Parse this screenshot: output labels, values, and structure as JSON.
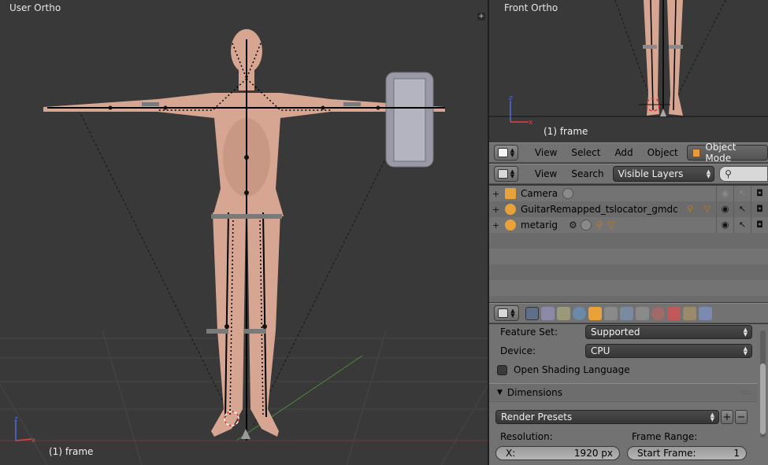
{
  "main_view": {
    "title": "User Ortho",
    "frame": "(1) frame"
  },
  "front_view": {
    "title": "Front Ortho",
    "frame": "(1) frame"
  },
  "view_header": {
    "menus": [
      "View",
      "Select",
      "Add",
      "Object"
    ],
    "mode": "Object Mode",
    "mode_icon": "cube-icon"
  },
  "outliner_header": {
    "menus": [
      "View",
      "Search"
    ],
    "display_mode": "Visible Layers",
    "search_icon": "magnifier-icon"
  },
  "outliner": {
    "items": [
      {
        "name": "Camera",
        "icon": "camera-icon",
        "color": "#e8a23a"
      },
      {
        "name": "GuitarRemapped_tslocator_gmdc",
        "icon": "armature-icon",
        "color": "#e8a23a"
      },
      {
        "name": "metarig",
        "icon": "armature-icon",
        "color": "#e8a23a"
      }
    ]
  },
  "properties": {
    "feature_set_label": "Feature Set:",
    "feature_set_value": "Supported",
    "device_label": "Device:",
    "device_value": "CPU",
    "osl_label": "Open Shading Language",
    "dimensions_title": "Dimensions",
    "render_presets": "Render Presets",
    "resolution_label": "Resolution:",
    "frame_range_label": "Frame Range:",
    "res_x_label": "X:",
    "res_x_value": "1920 px",
    "start_frame_label": "Start Frame:",
    "start_frame_value": "1"
  },
  "colors": {
    "viewport_bg": "#393939",
    "panel_bg": "#727272",
    "active_tab": "#5f6e89",
    "skin": "#d9aa96"
  }
}
